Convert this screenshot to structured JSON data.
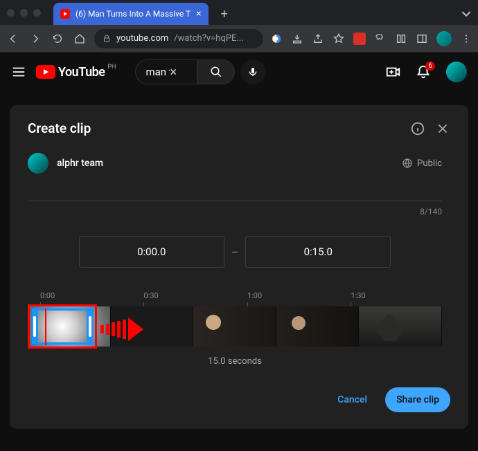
{
  "browser": {
    "tab_title": "(6) Man Turns Into A Massive T",
    "url_host": "youtube.com",
    "url_path": "/watch?v=hqPE..."
  },
  "yt_header": {
    "country_code": "PH",
    "logo_text": "YouTube",
    "search_value": "man tu",
    "notification_count": "6"
  },
  "clip": {
    "title": "Create clip",
    "user_name": "alphr team",
    "visibility": "Public",
    "char_counter": "8/140",
    "start_time": "0:00.0",
    "end_time": "0:15.0",
    "time_separator": "–",
    "ticks": [
      "0:00",
      "0:30",
      "1:00",
      "1:30"
    ],
    "duration": "15.0 seconds",
    "cancel_label": "Cancel",
    "share_label": "Share clip"
  }
}
